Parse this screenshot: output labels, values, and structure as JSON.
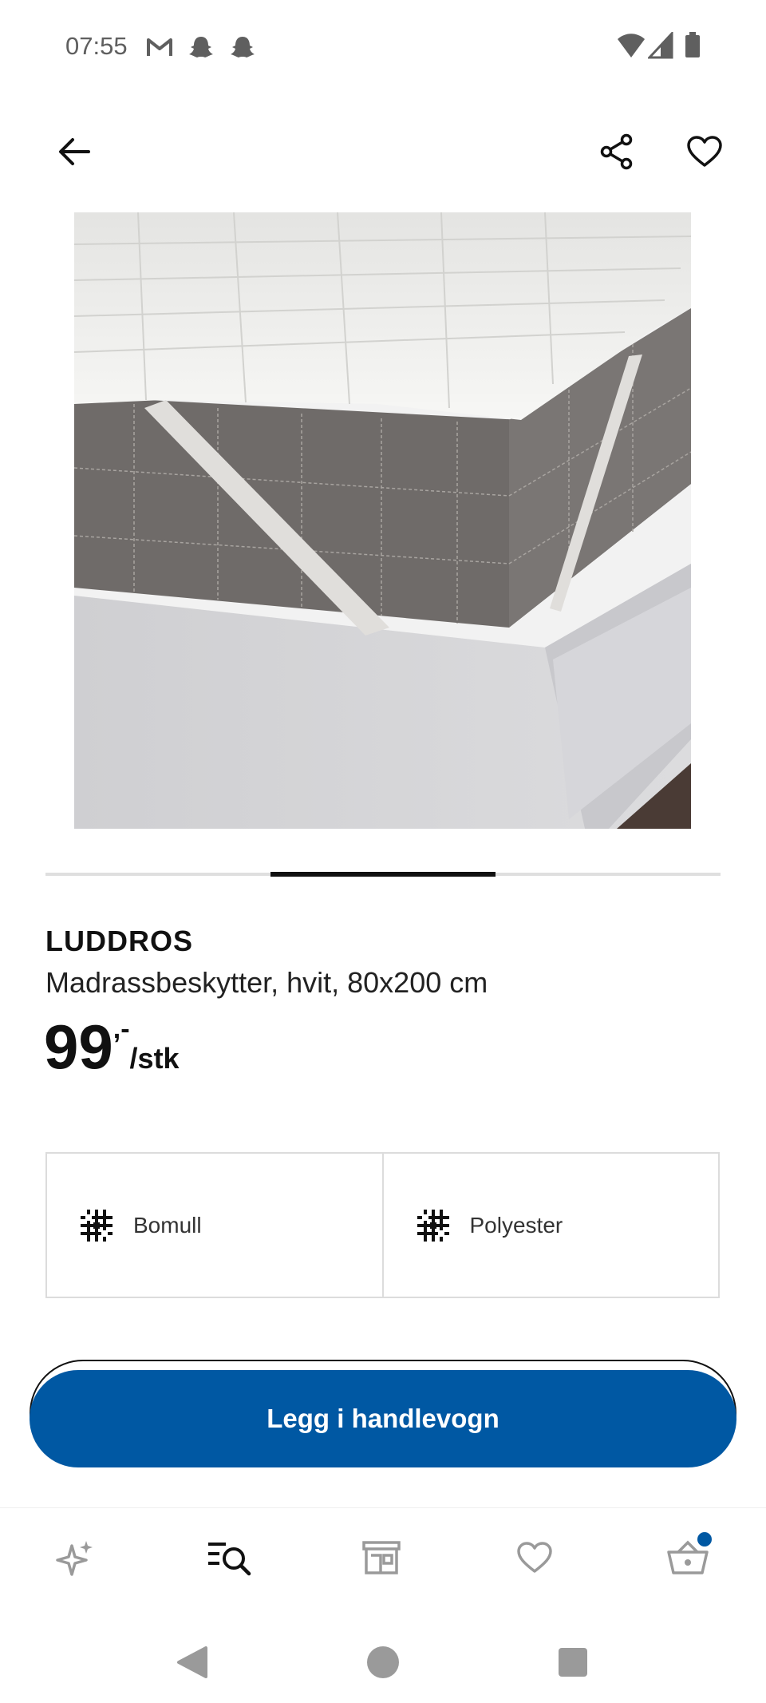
{
  "status_bar": {
    "time": "07:55",
    "notification_icons": [
      "gmail-icon",
      "snapchat-icon",
      "snapchat-icon"
    ],
    "system_icons": [
      "wifi-icon",
      "signal-icon",
      "battery-icon"
    ]
  },
  "app_bar": {
    "back_icon": "arrow-left-icon",
    "share_icon": "share-icon",
    "favorite_icon": "heart-icon"
  },
  "carousel": {
    "active_index": 2,
    "total": 3
  },
  "product": {
    "name": "LUDDROS",
    "description": "Madrassbeskytter, hvit, 80x200 cm",
    "price_integer": "99",
    "price_decimal": ",-",
    "price_unit": "/stk"
  },
  "materials": [
    {
      "icon": "fabric-weave-icon",
      "label": "Bomull"
    },
    {
      "icon": "fabric-weave-icon",
      "label": "Polyester"
    }
  ],
  "cta": {
    "label": "Legg i handlevogn"
  },
  "bottom_nav": [
    {
      "name": "inspiration",
      "icon": "sparkle-icon",
      "active": false
    },
    {
      "name": "search",
      "icon": "search-list-icon",
      "active": true
    },
    {
      "name": "stores",
      "icon": "store-icon",
      "active": false
    },
    {
      "name": "favorites",
      "icon": "heart-icon",
      "active": false
    },
    {
      "name": "cart",
      "icon": "basket-icon",
      "active": false,
      "badge": true
    }
  ],
  "colors": {
    "brand_blue": "#0058a3",
    "text": "#111111",
    "inactive_icon": "#9a9a9a",
    "border": "#dcdcdc"
  }
}
